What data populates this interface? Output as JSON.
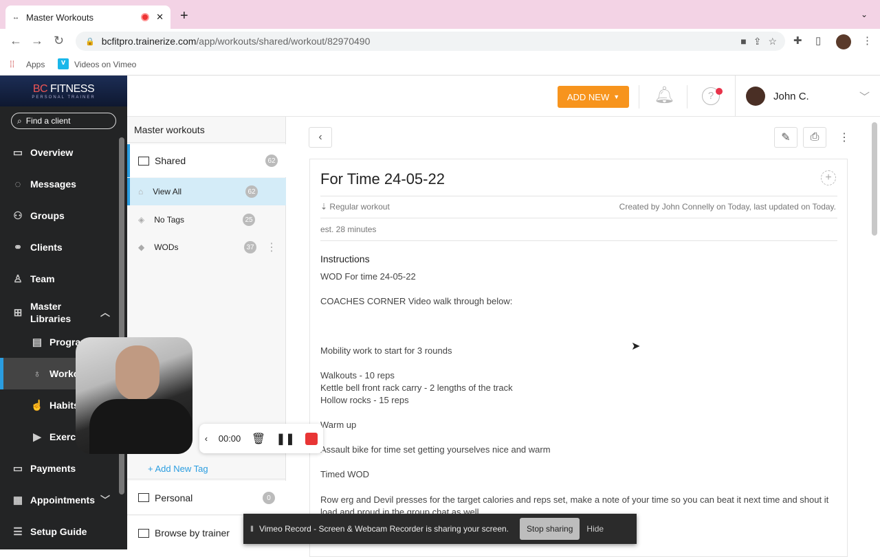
{
  "browser": {
    "tab_title": "Master Workouts",
    "url_domain": "bcfitpro.trainerize.com",
    "url_path": "/app/workouts/shared/workout/82970490",
    "bookmarks": [
      "Apps",
      "Videos on Vimeo"
    ]
  },
  "logo": {
    "text": "BC FITNESS",
    "sub": "PERSONAL TRAINER"
  },
  "sidebar": {
    "search_placeholder": "Find a client",
    "items": [
      {
        "label": "Overview"
      },
      {
        "label": "Messages"
      },
      {
        "label": "Groups"
      },
      {
        "label": "Clients"
      },
      {
        "label": "Team"
      },
      {
        "label": "Master Libraries"
      },
      {
        "label": "Programs"
      },
      {
        "label": "Workouts"
      },
      {
        "label": "Habits"
      },
      {
        "label": "Exercises"
      },
      {
        "label": "Payments"
      },
      {
        "label": "Appointments"
      },
      {
        "label": "Setup Guide"
      }
    ]
  },
  "header": {
    "add_new": "ADD NEW",
    "user": "John C."
  },
  "library": {
    "title": "Master workouts",
    "shared": {
      "label": "Shared",
      "count": "62"
    },
    "tags": [
      {
        "label": "View All",
        "count": "62"
      },
      {
        "label": "No Tags",
        "count": "25"
      },
      {
        "label": "WODs",
        "count": "37"
      }
    ],
    "add_tag": "+ Add New Tag",
    "personal": {
      "label": "Personal",
      "count": "0"
    },
    "browse": "Browse by trainer"
  },
  "workout": {
    "title": "For Time 24-05-22",
    "type": "Regular workout",
    "created": "Created by John Connelly on Today, last updated on Today.",
    "estimate": "est. 28 minutes",
    "instructions_label": "Instructions",
    "lines": [
      "WOD For time 24-05-22",
      "COACHES CORNER Video walk through below:",
      "Mobility work to start for 3 rounds",
      "Walkouts - 10 reps",
      "Kettle bell front rack carry - 2 lengths of the track",
      "Hollow rocks - 15 reps",
      "Warm up",
      "Assault bike for time set getting yourselves nice and warm",
      "Timed WOD",
      "Row erg and Devil presses for the target calories and reps set, make a note of your time so you can beat it next time and shout it load and proud in the group chat as well"
    ]
  },
  "recorder": {
    "time": "00:00"
  },
  "share_bar": {
    "message": "Vimeo Record - Screen & Webcam Recorder is sharing your screen.",
    "stop": "Stop sharing",
    "hide": "Hide"
  }
}
